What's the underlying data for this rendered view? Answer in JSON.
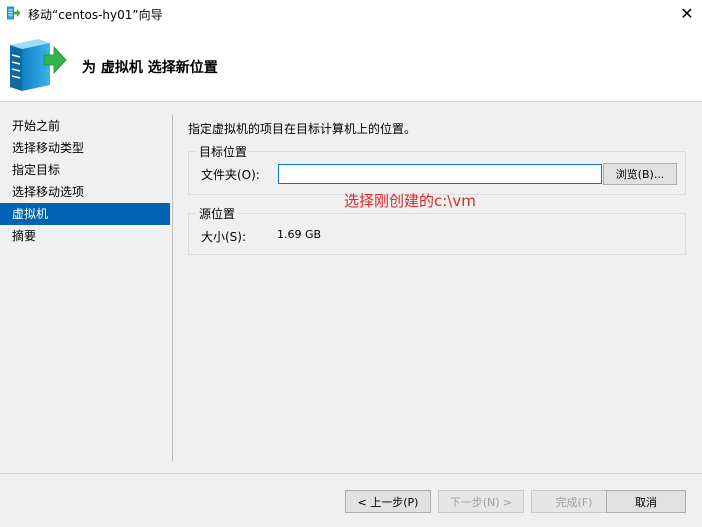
{
  "window": {
    "title": "移动“centos-hy01”向导",
    "close_glyph": "✕",
    "app_icon": "server-arrow-icon"
  },
  "header": {
    "heading": "为 虚拟机 选择新位置",
    "icon": "server-move-icon"
  },
  "nav": {
    "items": [
      {
        "label": "开始之前",
        "active": false
      },
      {
        "label": "选择移动类型",
        "active": false
      },
      {
        "label": "指定目标",
        "active": false
      },
      {
        "label": "选择移动选项",
        "active": false
      },
      {
        "label": "虚拟机",
        "active": true
      },
      {
        "label": "摘要",
        "active": false
      }
    ]
  },
  "content": {
    "intro": "指定虚拟机的项目在目标计算机上的位置。",
    "target_group": {
      "label": "目标位置",
      "folder_label": "文件夹(O):",
      "folder_value": "",
      "browse_label": "浏览(B)..."
    },
    "source_group": {
      "label": "源位置",
      "size_label": "大小(S):",
      "size_value": "1.69 GB"
    },
    "annotation": "选择刚创建的c:\\vm"
  },
  "footer": {
    "back_label": "< 上一步(P)",
    "next_label": "下一步(N) >",
    "finish_label": "完成(F)",
    "cancel_label": "取消"
  },
  "colors": {
    "accent": "#0063b1",
    "annotation": "#e0262b"
  }
}
